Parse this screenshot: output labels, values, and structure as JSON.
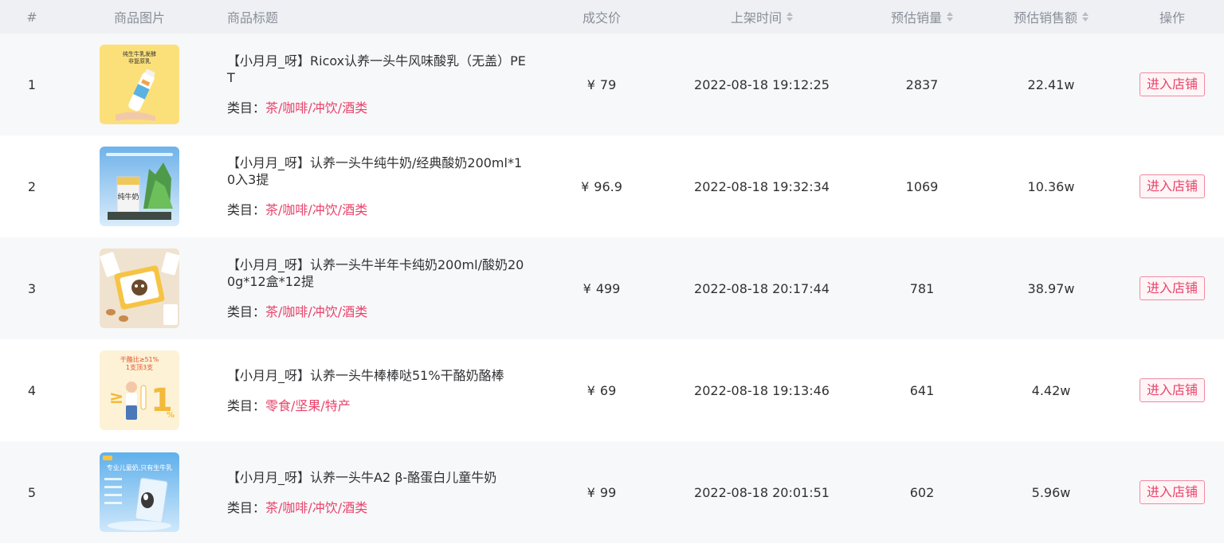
{
  "header": {
    "index": "#",
    "image": "商品图片",
    "title": "商品标题",
    "price": "成交价",
    "list_time": "上架时间",
    "est_sales": "预估销量",
    "est_amount": "预估销售额",
    "action": "操作"
  },
  "currency_symbol": "¥",
  "category_prefix": "类目：",
  "rows": [
    {
      "index": "1",
      "image_text": "纯生牛乳发酵\n非复原乳",
      "title": "【小月月_呀】Ricox认养一头牛风味酸乳（无盖）PET",
      "category": "茶/咖啡/冲饮/酒类",
      "price": "79",
      "time": "2022-08-18 19:12:25",
      "sales": "2837",
      "amount": "22.41w",
      "button": "进入店铺"
    },
    {
      "index": "2",
      "image_text": "",
      "title": "【小月月_呀】认养一头牛纯牛奶/经典酸奶200ml*10入3提",
      "category": "茶/咖啡/冲饮/酒类",
      "price": "96.9",
      "time": "2022-08-18 19:32:34",
      "sales": "1069",
      "amount": "10.36w",
      "button": "进入店铺"
    },
    {
      "index": "3",
      "image_text": "",
      "title": "【小月月_呀】认养一头牛半年卡纯奶200ml/酸奶200g*12盒*12提",
      "category": "茶/咖啡/冲饮/酒类",
      "price": "499",
      "time": "2022-08-18 20:17:44",
      "sales": "781",
      "amount": "38.97w",
      "button": "进入店铺"
    },
    {
      "index": "4",
      "image_text": "干酪比≥51%\n1支顶3支",
      "title": "【小月月_呀】认养一头牛棒棒哒51%干酪奶酪棒",
      "category": "零食/坚果/特产",
      "price": "69",
      "time": "2022-08-18 19:13:46",
      "sales": "641",
      "amount": "4.42w",
      "button": "进入店铺"
    },
    {
      "index": "5",
      "image_text": "专业儿童奶,只有生牛乳",
      "title": "【小月月_呀】认养一头牛A2 β-酪蛋白儿童牛奶",
      "category": "茶/咖啡/冲饮/酒类",
      "price": "99",
      "time": "2022-08-18 20:01:51",
      "sales": "602",
      "amount": "5.96w",
      "button": "进入店铺"
    }
  ]
}
